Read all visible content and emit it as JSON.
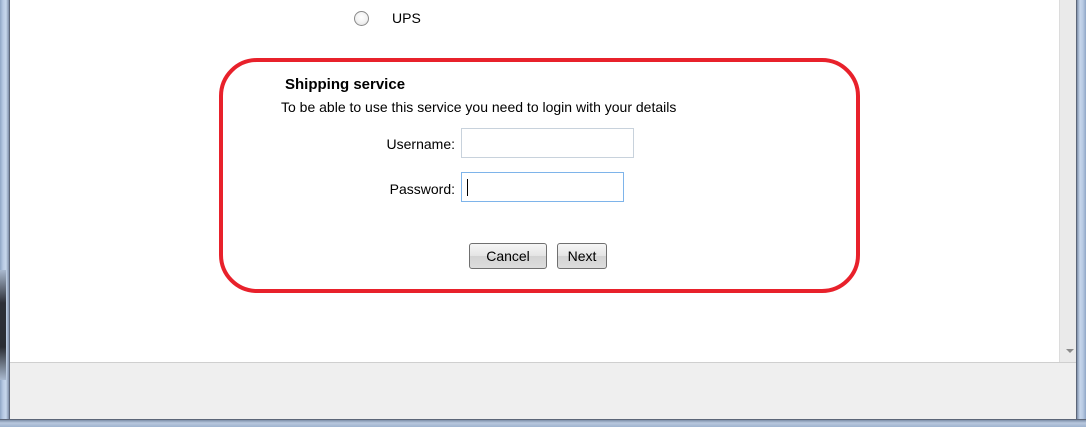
{
  "shipping": {
    "option_label": "UPS",
    "title": "Shipping service",
    "description": "To be able to use this service you need to login with your details",
    "username_label": "Username:",
    "username_value": "",
    "password_label": "Password:",
    "password_value": "",
    "cancel_label": "Cancel",
    "next_label": "Next"
  },
  "colors": {
    "highlight": "#e8212b",
    "focus_border": "#7eb4ea"
  }
}
